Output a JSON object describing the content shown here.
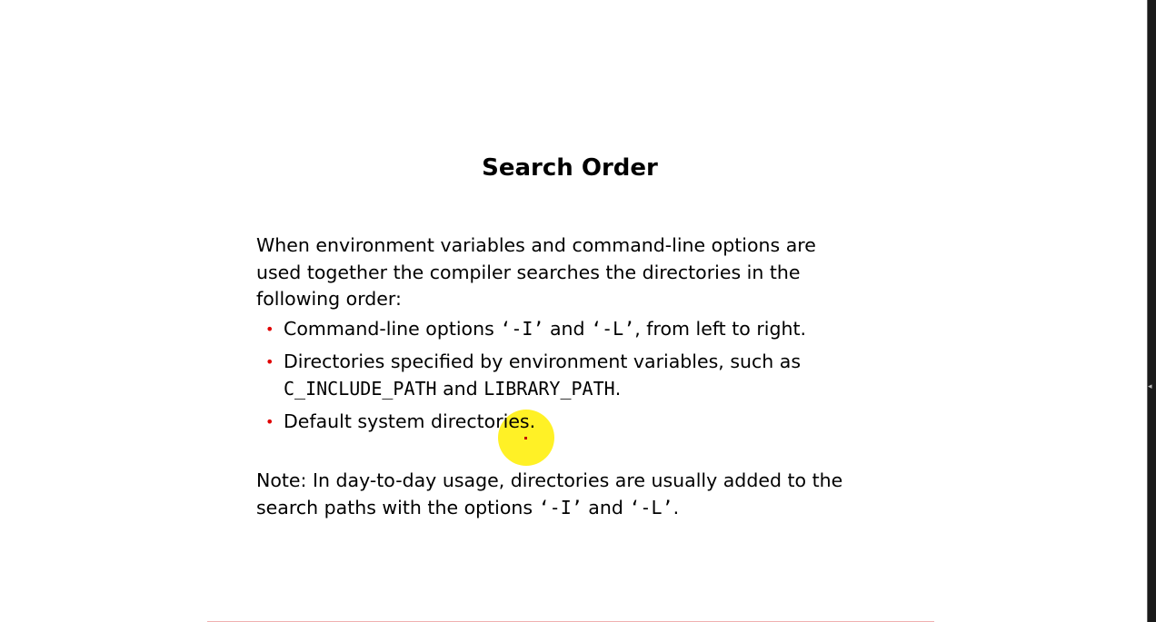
{
  "slide": {
    "title": "Search Order",
    "intro": {
      "line1": "When environment variables and command-line options are",
      "line2": "used together the compiler searches the directories in the",
      "line3": "following order:"
    },
    "bullets": [
      {
        "pre": "Command-line options ",
        "code1": "‘-I’",
        "mid": " and ",
        "code2": "‘-L’",
        "post": ", from left to right."
      },
      {
        "line1": "Directories specified by environment variables, such as",
        "code1": "C_INCLUDE_PATH",
        "mid": " and ",
        "code2": "LIBRARY_PATH",
        "post": "."
      },
      {
        "text": "Default system directories."
      }
    ],
    "note": {
      "line1": "Note: In day-to-day usage, directories are usually added to the",
      "line2_pre": "search paths with the options ",
      "code1": "‘-I’",
      "mid": " and ",
      "code2": "‘-L’",
      "post": "."
    },
    "bullet_color": "#e00000"
  },
  "cursor": {
    "highlight_color": "#ffee00"
  },
  "icons": {
    "bullet": "•",
    "collapse_arrow": "◂"
  }
}
